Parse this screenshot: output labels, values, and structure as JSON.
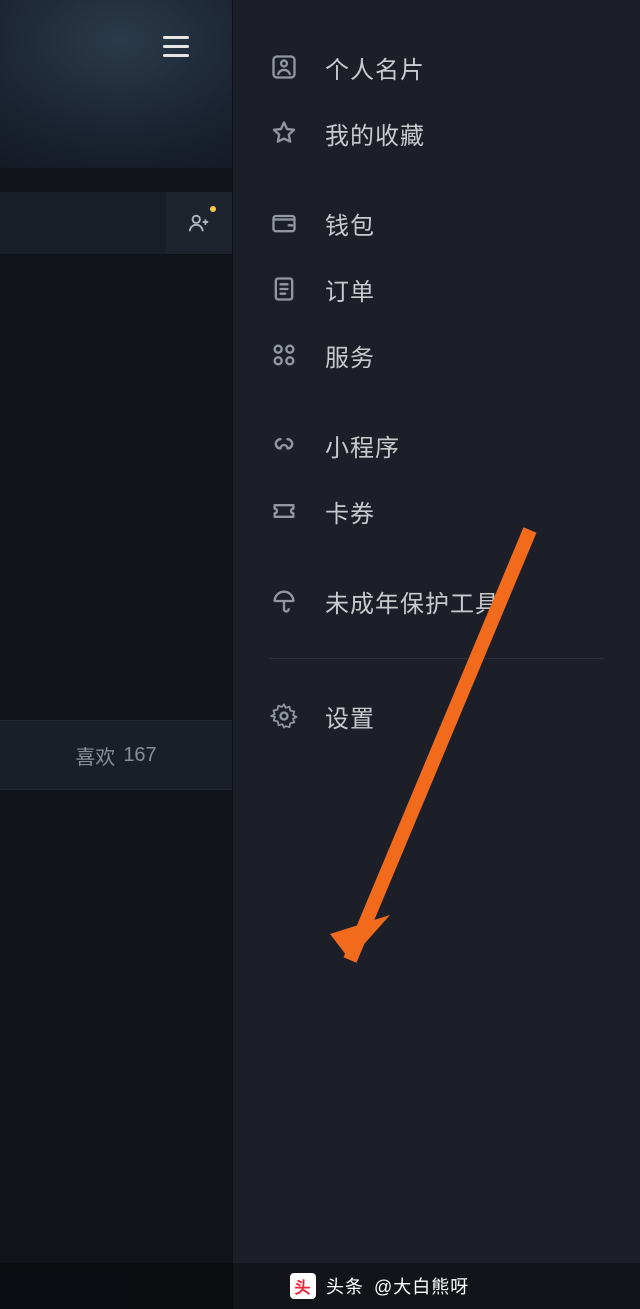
{
  "left_panel": {
    "likes_label": "喜欢",
    "likes_count": 167
  },
  "menu": {
    "profile_card": "个人名片",
    "favorites": "我的收藏",
    "wallet": "钱包",
    "orders": "订单",
    "services": "服务",
    "mini_program": "小程序",
    "coupons": "卡券",
    "minor_protection": "未成年保护工具",
    "settings": "设置"
  },
  "footer": {
    "source_label": "头条",
    "author": "@大白熊呀"
  }
}
